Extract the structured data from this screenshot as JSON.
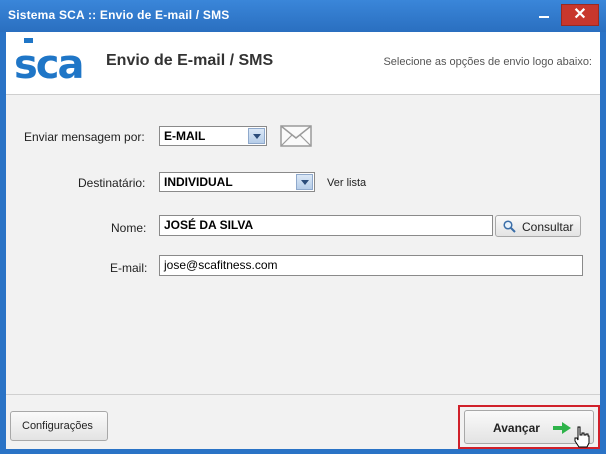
{
  "window": {
    "title": "Sistema SCA :: Envio de E-mail / SMS",
    "close_label": "✕"
  },
  "header": {
    "logo_text": "SCA",
    "title": "Envio de E-mail / SMS",
    "hint": "Selecione as opções de envio logo abaixo:"
  },
  "form": {
    "send_via": {
      "label": "Enviar mensagem por:",
      "value": "E-MAIL"
    },
    "recipient": {
      "label": "Destinatário:",
      "value": "INDIVIDUAL",
      "link": "Ver lista"
    },
    "name": {
      "label": "Nome:",
      "value": "JOSÉ DA SILVA",
      "button": "Consultar"
    },
    "email": {
      "label": "E-mail:",
      "value": "jose@scafitness.com"
    }
  },
  "footer": {
    "settings_button": "Configurações",
    "next_button": "Avançar"
  },
  "colors": {
    "titlebar": "#2a73c6",
    "close": "#c8372d",
    "logo": "#1f76c7",
    "highlight": "#d0202a",
    "arrow": "#2eb34a"
  }
}
